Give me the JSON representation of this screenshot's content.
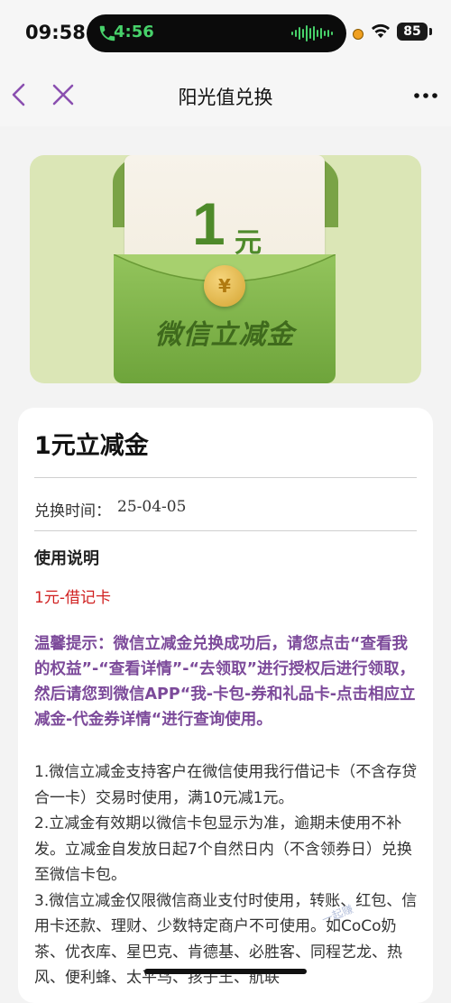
{
  "status_bar": {
    "time": "09:58",
    "call_time": "4:56",
    "battery": "85"
  },
  "nav": {
    "title": "阳光值兑换"
  },
  "banner": {
    "amount": "1",
    "unit": "元",
    "coin_symbol": "¥",
    "pocket_text": "微信立减金"
  },
  "detail": {
    "title": "1元立减金",
    "exchange_time_label": "兑换时间：",
    "exchange_time_value": "25-04-05",
    "usage_heading": "使用说明",
    "card_type": "1元-借记卡",
    "tip": "温馨提示：微信立减金兑换成功后，请您点击“查看我的权益”-“查看详情”-“去领取”进行授权后进行领取，然后请您到微信APP“我-卡包-券和礼品卡-点击相应立减金-代金券详情“进行查询使用。",
    "rules": [
      "1.微信立减金支持客户在微信使用我行借记卡（不含存贷合一卡）交易时使用，满10元减1元。",
      "2.立减金有效期以微信卡包显示为准，逾期未使用不补发。立减金自发放日起7个自然日内（不含领券日）兑换至微信卡包。",
      "3.微信立减金仅限微信商业支付时使用，转账、红包、信用卡还款、理财、少数特定商户不可使用。如CoCo奶茶、优衣库、星巴克、肯德基、必胜客、同程艺龙、热风、便利蜂、太平鸟、孩子王、航联"
    ]
  },
  "watermark": "一起赚",
  "colors": {
    "accent_purple": "#7c4a9a",
    "red": "#d02020",
    "green": "#4e8a2a",
    "call_green": "#47d16a"
  }
}
